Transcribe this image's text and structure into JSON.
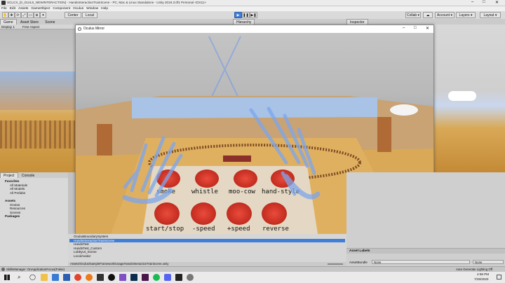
{
  "window": {
    "title": "SCLCX_(0_GUILS_NEWINTERACTION) - HandsInteractionTrainScene - PC, Mac & Linux Standalone - Unity 2019.3.0f1 Personal <DX11>"
  },
  "menu": [
    "File",
    "Edit",
    "Assets",
    "GameObject",
    "Component",
    "Oculus",
    "Window",
    "Help"
  ],
  "toolbar": {
    "pivot": "Center",
    "space": "Local",
    "collab": "Collab ▾",
    "account": "Account ▾",
    "layers": "Layers ▾",
    "layout": "Layout ▾"
  },
  "game_tabs": [
    "Game",
    "Asset Store",
    "Scene"
  ],
  "game_bar": {
    "display": "Display 1",
    "aspect": "Free Aspect"
  },
  "hierarchy_tab": "Hierarchy",
  "inspector_tab": "Inspector",
  "oculus_window": {
    "title": "Oculus Mirror",
    "controls": [
      "–",
      "□",
      "✕"
    ]
  },
  "buttons_row1": [
    "smoke",
    "whistle",
    "moo-cow",
    "hand-style"
  ],
  "buttons_row2": [
    "start/stop",
    "-speed",
    "+speed",
    "reverse"
  ],
  "project_tabs": [
    "Project",
    "Console"
  ],
  "project_tree": [
    {
      "label": "Favorites",
      "indent": 0,
      "bold": true
    },
    {
      "label": "All Materials",
      "indent": 1,
      "bold": false
    },
    {
      "label": "All Models",
      "indent": 1,
      "bold": false
    },
    {
      "label": "All Prefabs",
      "indent": 1,
      "bold": false
    },
    {
      "label": "",
      "indent": 0,
      "bold": false
    },
    {
      "label": "Assets",
      "indent": 0,
      "bold": true
    },
    {
      "label": "Oculus",
      "indent": 1,
      "bold": false
    },
    {
      "label": "Resources",
      "indent": 1,
      "bold": false
    },
    {
      "label": "Scenes",
      "indent": 1,
      "bold": false
    },
    {
      "label": "Packages",
      "indent": 0,
      "bold": true
    }
  ],
  "hierarchy_items": [
    {
      "label": "OculusBoundarySystem",
      "selected": false
    },
    {
      "label": "HandsInteractionTrainScene",
      "selected": true
    },
    {
      "label": "HandsTest",
      "selected": false
    },
    {
      "label": "HandsTest_Custom",
      "selected": false
    },
    {
      "label": "LobbyUI_Scene",
      "selected": false
    },
    {
      "label": "LocalAvatar",
      "selected": false
    }
  ],
  "path_bar": "Assets/Oculus/SampleFramework/Usage/HandsInteractionTrainScene.unity",
  "asset_labels": {
    "title": "Asset Labels",
    "bundle_label": "AssetBundle",
    "bundle_value": "None",
    "variant_value": "None"
  },
  "status": {
    "left": "SkillsManager: OnApplicationFocus(False)",
    "right": "Auto Generate Lighting Off"
  },
  "taskbar": {
    "time": "4:58 PM",
    "date": "7/29/2020"
  }
}
